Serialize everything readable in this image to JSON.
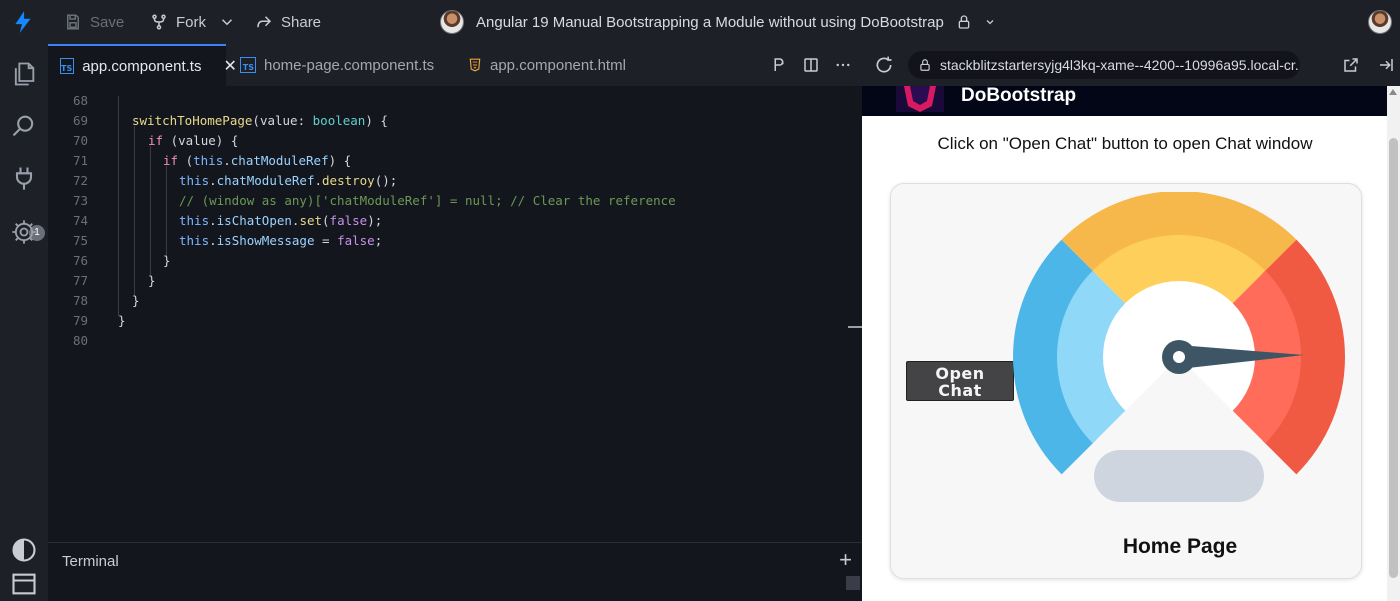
{
  "topbar": {
    "save_label": "Save",
    "fork_label": "Fork",
    "share_label": "Share",
    "project_title": "Angular 19 Manual Bootstrapping a Module without using DoBootstrap"
  },
  "tabs": [
    {
      "label": "app.component.ts",
      "active": true
    },
    {
      "label": "home-page.component.ts",
      "active": false
    },
    {
      "label": "app.component.html",
      "active": false
    }
  ],
  "activity": {
    "badge_count": "1"
  },
  "editor": {
    "lines": [
      {
        "n": "68"
      },
      {
        "n": "69"
      },
      {
        "n": "70"
      },
      {
        "n": "71"
      },
      {
        "n": "72"
      },
      {
        "n": "73"
      },
      {
        "n": "74"
      },
      {
        "n": "75"
      },
      {
        "n": "76"
      },
      {
        "n": "77"
      },
      {
        "n": "78"
      },
      {
        "n": "79"
      },
      {
        "n": "80"
      }
    ],
    "code": {
      "l69": {
        "fn": "switchToHomePage",
        "param": "value",
        "type": "boolean"
      },
      "l70": {
        "kw": "if",
        "cond": "value"
      },
      "l71": {
        "kw": "if",
        "this": "this",
        "prop": "chatModuleRef"
      },
      "l72": {
        "this": "this",
        "prop": "chatModuleRef",
        "fn": "destroy"
      },
      "l73": {
        "comment": "// (window as any)['chatModuleRef'] = null; // Clear the reference"
      },
      "l74": {
        "this": "this",
        "prop": "isChatOpen",
        "fn": "set",
        "val": "false"
      },
      "l75": {
        "this": "this",
        "prop": "isShowMessage",
        "val": "false"
      }
    }
  },
  "terminal": {
    "label": "Terminal"
  },
  "preview": {
    "url": "stackblitzstartersyjg4l3kq-xame--4200--10996a95.local-cr...",
    "brand_name": "DoBootstrap",
    "instruction": "Click on \"Open Chat\" button to open Chat window",
    "open_chat_line1": "Open",
    "open_chat_line2": "Chat",
    "home_title": "Home Page",
    "gauge_level": 0.83
  },
  "colors": {
    "accent": "#3b82f6",
    "gauge_blue": "#4db6e8",
    "gauge_yellow": "#f7b84b",
    "gauge_red": "#f05a42",
    "needle": "#3e5566"
  }
}
